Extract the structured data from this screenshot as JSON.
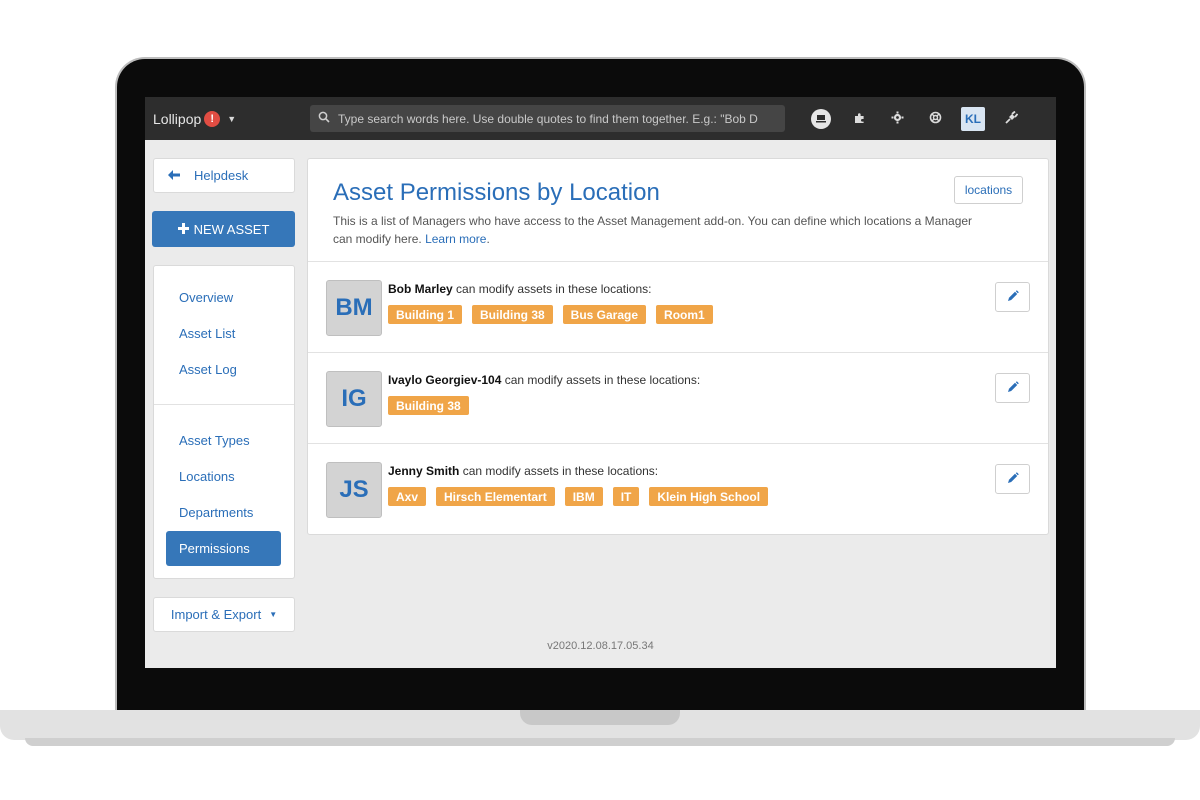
{
  "topbar": {
    "brand": "Lollipop",
    "brand_alert": "!",
    "search_placeholder": "Type search words here. Use double quotes to find them together. E.g.: \"Bob D",
    "user_initials": "KL"
  },
  "sidebar": {
    "back_label": "Helpdesk",
    "new_asset_label": "NEW ASSET",
    "nav_items": [
      "Overview",
      "Asset List",
      "Asset Log",
      "Asset Types",
      "Locations",
      "Departments"
    ],
    "active_item": "Permissions",
    "import_label": "Import & Export"
  },
  "main": {
    "title": "Asset Permissions by Location",
    "description": "This is a list of Managers who have access to the Asset Management add-on. You can define which locations a Manager can modify here.",
    "learn_more": "Learn more",
    "locations_button": "locations",
    "suffix_text": "can modify assets in these locations:",
    "managers": [
      {
        "initials": "BM",
        "name": "Bob Marley",
        "locations": [
          "Building 1",
          "Building 38",
          "Bus Garage",
          "Room1"
        ]
      },
      {
        "initials": "IG",
        "name": "Ivaylo Georgiev-104",
        "locations": [
          "Building 38"
        ]
      },
      {
        "initials": "JS",
        "name": "Jenny Smith",
        "locations": [
          "Axv",
          "Hirsch Elementart",
          "IBM",
          "IT",
          "Klein High School"
        ]
      }
    ]
  },
  "footer": {
    "version": "v2020.12.08.17.05.34"
  },
  "colors": {
    "accent": "#2a6eb8",
    "primary_button": "#3677b9",
    "tag": "#f0a548",
    "topbar": "#2d2d2d"
  },
  "icons": [
    "search-icon",
    "computer-icon",
    "puzzle-icon",
    "gear-icon",
    "lifebuoy-icon",
    "plug-icon",
    "arrow-left-icon",
    "plus-icon",
    "pencil-icon",
    "caret-down-icon"
  ]
}
